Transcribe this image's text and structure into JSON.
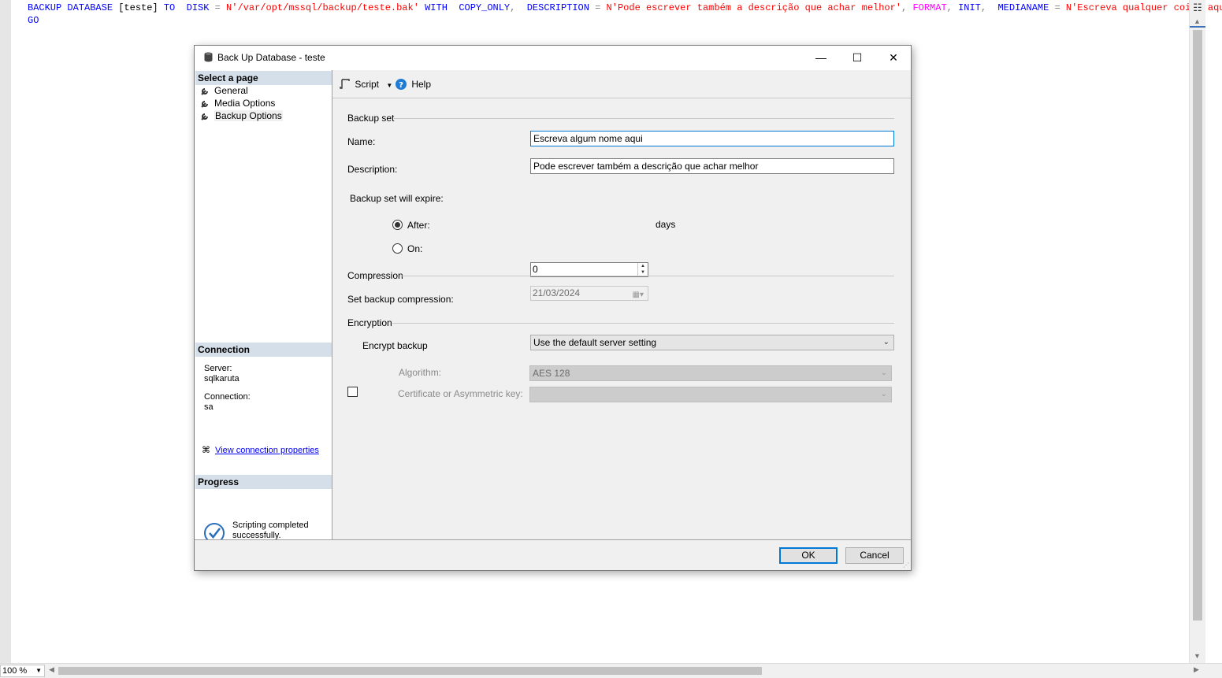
{
  "editor": {
    "line1": {
      "t1": "BACKUP DATABASE ",
      "t2": "[teste]",
      "t3": " TO  DISK ",
      "t4": "=",
      "t5": " N'/var/opt/mssql/backup/teste.bak'",
      "t6": " WITH  COPY_ONLY",
      "t7": ",",
      "t8": "  DESCRIPTION ",
      "t9": "=",
      "t10": " N'Pode escrever também a descrição que achar melhor'",
      "t11": ", ",
      "t12": "FORMAT",
      "t13": ", ",
      "t14": "INIT",
      "t15": ",  ",
      "t16": "MEDIANAME ",
      "t17": "=",
      "t18": " N'Escreva qualquer coisa aqui a"
    },
    "line2": "GO",
    "split_icon": "split-icon",
    "zoom": "100 %"
  },
  "dialog": {
    "title": "Back Up Database - teste",
    "select_page_header": "Select a page",
    "pages": [
      {
        "label": "General"
      },
      {
        "label": "Media Options"
      },
      {
        "label": "Backup Options"
      }
    ],
    "connection_header": "Connection",
    "server_label": "Server:",
    "server_value": "sqlkaruta",
    "connection_label": "Connection:",
    "connection_value": "sa",
    "view_connection_link": "View connection properties",
    "progress_header": "Progress",
    "progress_text_1": "Scripting completed",
    "progress_text_2": "successfully.",
    "toolbar": {
      "script_label": "Script",
      "help_label": "Help"
    },
    "backup_set_group": "Backup set",
    "name_label": "Name:",
    "name_value": "Escreva algum nome aqui",
    "description_label": "Description:",
    "description_value": "Pode escrever também a descrição que achar melhor",
    "expire_label": "Backup set will expire:",
    "after_label": "After:",
    "after_value": "0",
    "days_label": "days",
    "on_label": "On:",
    "on_value": "21/03/2024",
    "compression_group": "Compression",
    "set_compression_label": "Set backup compression:",
    "compression_value": "Use the default server setting",
    "encryption_group": "Encryption",
    "encrypt_label": "Encrypt backup",
    "algorithm_label": "Algorithm:",
    "algorithm_value": "AES 128",
    "certificate_label": "Certificate or Asymmetric key:",
    "certificate_value": "",
    "ok_label": "OK",
    "cancel_label": "Cancel"
  },
  "colors": {
    "keyword": "#0000ff",
    "string": "#ff0000",
    "function": "#ff00ff",
    "section_header_bg": "#d5dfea",
    "focus_border": "#0078d7",
    "link": "#0000ee"
  }
}
